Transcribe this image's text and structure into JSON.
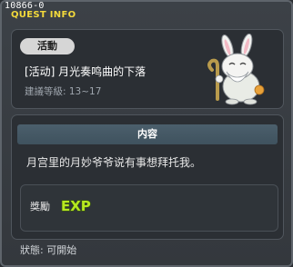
{
  "window": {
    "quest_id": "10866-0",
    "title": "QUEST INFO"
  },
  "quest": {
    "category": "活動",
    "name": "[活动] 月光奏鸣曲的下落",
    "level": "建議等級: 13~17",
    "npc_icon": "rabbit-npc-icon"
  },
  "content": {
    "header": "内容",
    "description": "月宫里的月妙爷爷说有事想拜托我。"
  },
  "rewards": {
    "label": "獎勵",
    "exp_text": "EXP",
    "exp_icon": "exp-icon"
  },
  "status": {
    "text": "狀態:  可開始"
  },
  "colors": {
    "title": "#f3d93b",
    "exp_fill": "#b6e820",
    "section_header": "#46596a"
  }
}
